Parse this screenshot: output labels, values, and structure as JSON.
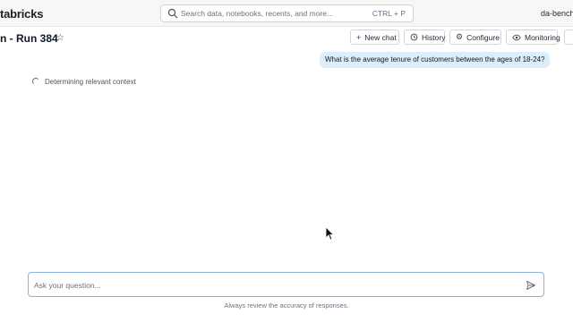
{
  "header": {
    "brand": "tabricks",
    "search_placeholder": "Search data, notebooks, recents, and more...",
    "shortcut": "CTRL + P",
    "workspace": "da-bench",
    "icons": {
      "search": "search-icon"
    }
  },
  "page": {
    "title": "n - Run 384",
    "favorite_icon": "star-icon"
  },
  "toolbar": {
    "new_chat": "New chat",
    "history": "History",
    "configure": "Configure",
    "monitoring": "Monitoring",
    "icons": [
      "plus-icon",
      "history-icon",
      "gear-icon",
      "eye-icon"
    ]
  },
  "chat": {
    "user_message": "What is the average tenure of customers between the ages of 18-24?",
    "status": "Determining relevant context"
  },
  "composer": {
    "placeholder": "Ask your question...",
    "disclaimer": "Always review the accuracy of responses."
  },
  "colors": {
    "user_bubble": "#dbeef9",
    "input_border": "#8ab4d8"
  }
}
